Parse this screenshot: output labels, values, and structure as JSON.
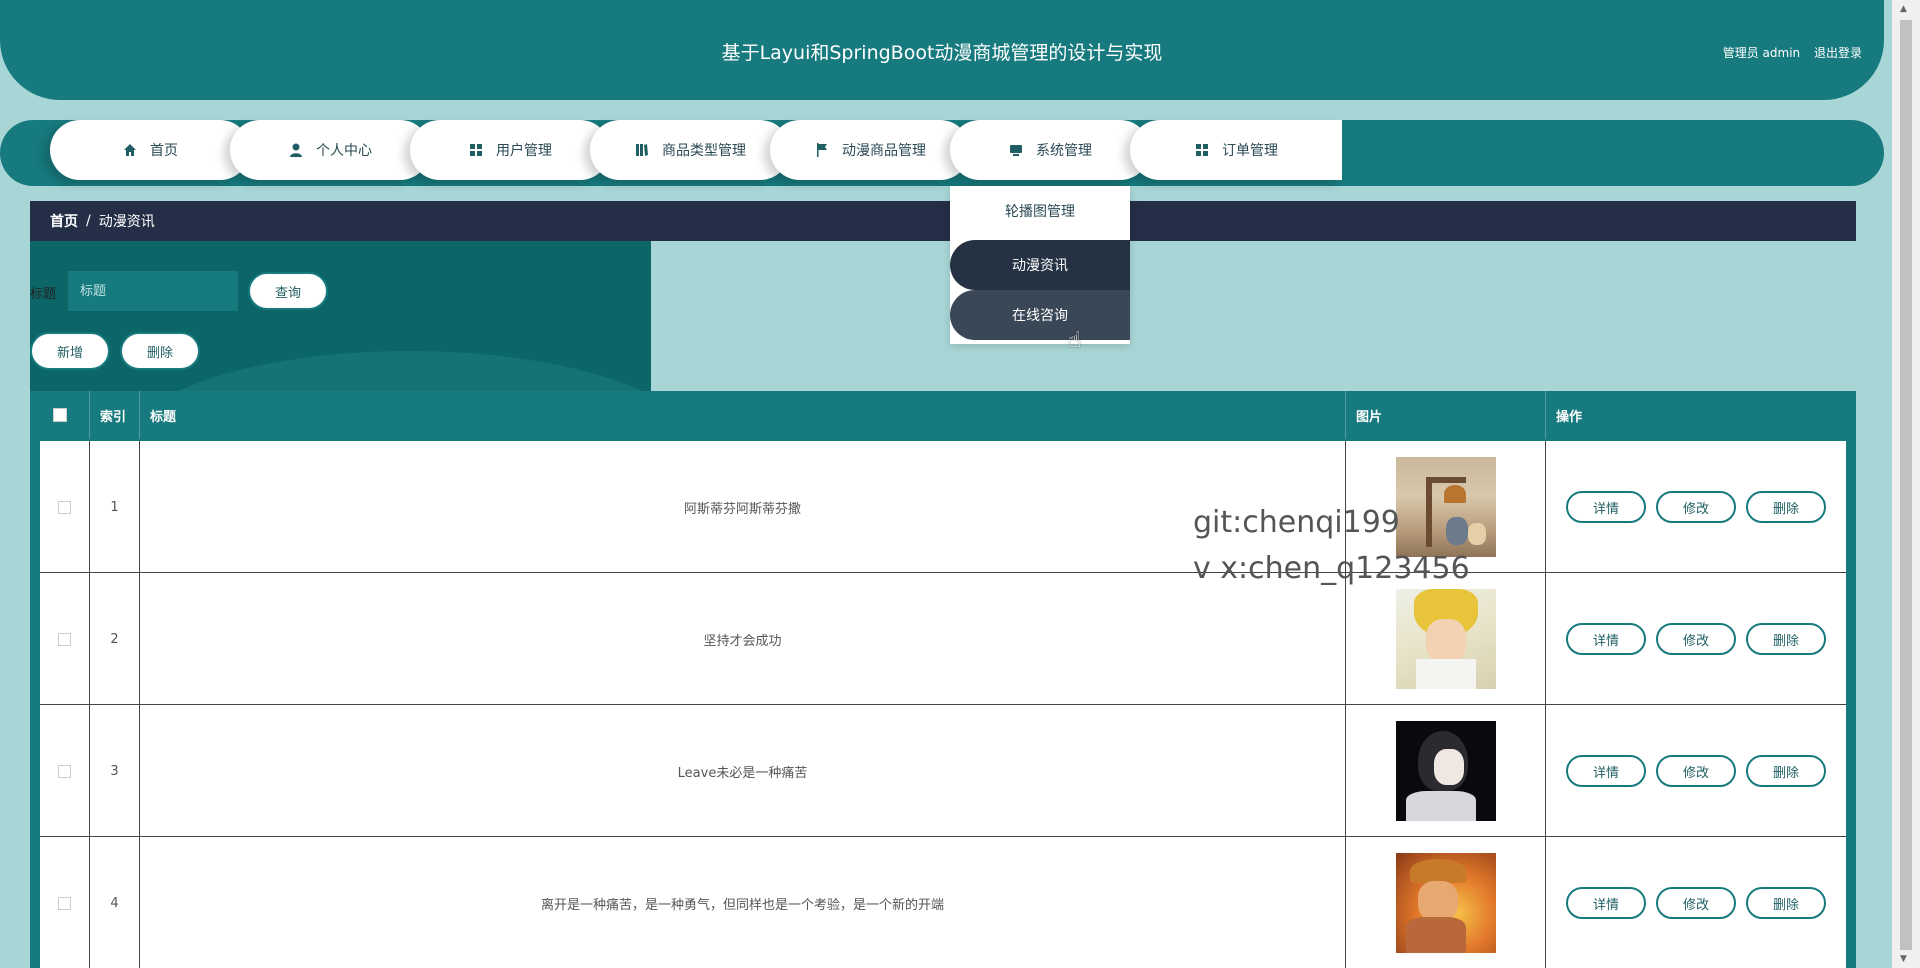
{
  "header": {
    "title": "基于Layui和SpringBoot动漫商城管理的设计与实现",
    "admin_label": "管理员 admin",
    "logout_label": "退出登录"
  },
  "nav": {
    "items": [
      {
        "label": "首页",
        "icon": "home-icon"
      },
      {
        "label": "个人中心",
        "icon": "user-icon"
      },
      {
        "label": "用户管理",
        "icon": "grid-icon"
      },
      {
        "label": "商品类型管理",
        "icon": "book-icon"
      },
      {
        "label": "动漫商品管理",
        "icon": "flag-icon"
      },
      {
        "label": "系统管理",
        "icon": "monitor-icon"
      },
      {
        "label": "订单管理",
        "icon": "grid-icon"
      }
    ]
  },
  "dropdown": {
    "items": [
      "轮播图管理",
      "动漫资讯",
      "在线咨询"
    ]
  },
  "breadcrumb": {
    "home": "首页",
    "separator": "/",
    "current": "动漫资讯"
  },
  "search": {
    "label": "标题",
    "placeholder": "标题",
    "query_button": "查询"
  },
  "actions": {
    "add_button": "新增",
    "delete_button": "删除"
  },
  "table": {
    "headers": [
      "索引",
      "标题",
      "图片",
      "操作"
    ],
    "rows": [
      {
        "index": "1",
        "title": "阿斯蒂芬阿斯蒂芬撒",
        "image": "figurine-photo"
      },
      {
        "index": "2",
        "title": "坚持才会成功",
        "image": "anime-blonde-character"
      },
      {
        "index": "3",
        "title": "Leave未必是一种痛苦",
        "image": "anime-dark-character"
      },
      {
        "index": "4",
        "title": "离开是一种痛苦，是一种勇气，但同样也是一个考验，是一个新的开端",
        "image": "anime-fire-character"
      }
    ],
    "op_labels": {
      "detail": "详情",
      "edit": "修改",
      "delete": "删除"
    }
  },
  "watermark": {
    "line1": "git:chenqi199",
    "line2": "v x:chen_q123456"
  },
  "colors": {
    "primary": "#177a7e",
    "dark": "#242f47",
    "background": "#a8d6d6"
  }
}
